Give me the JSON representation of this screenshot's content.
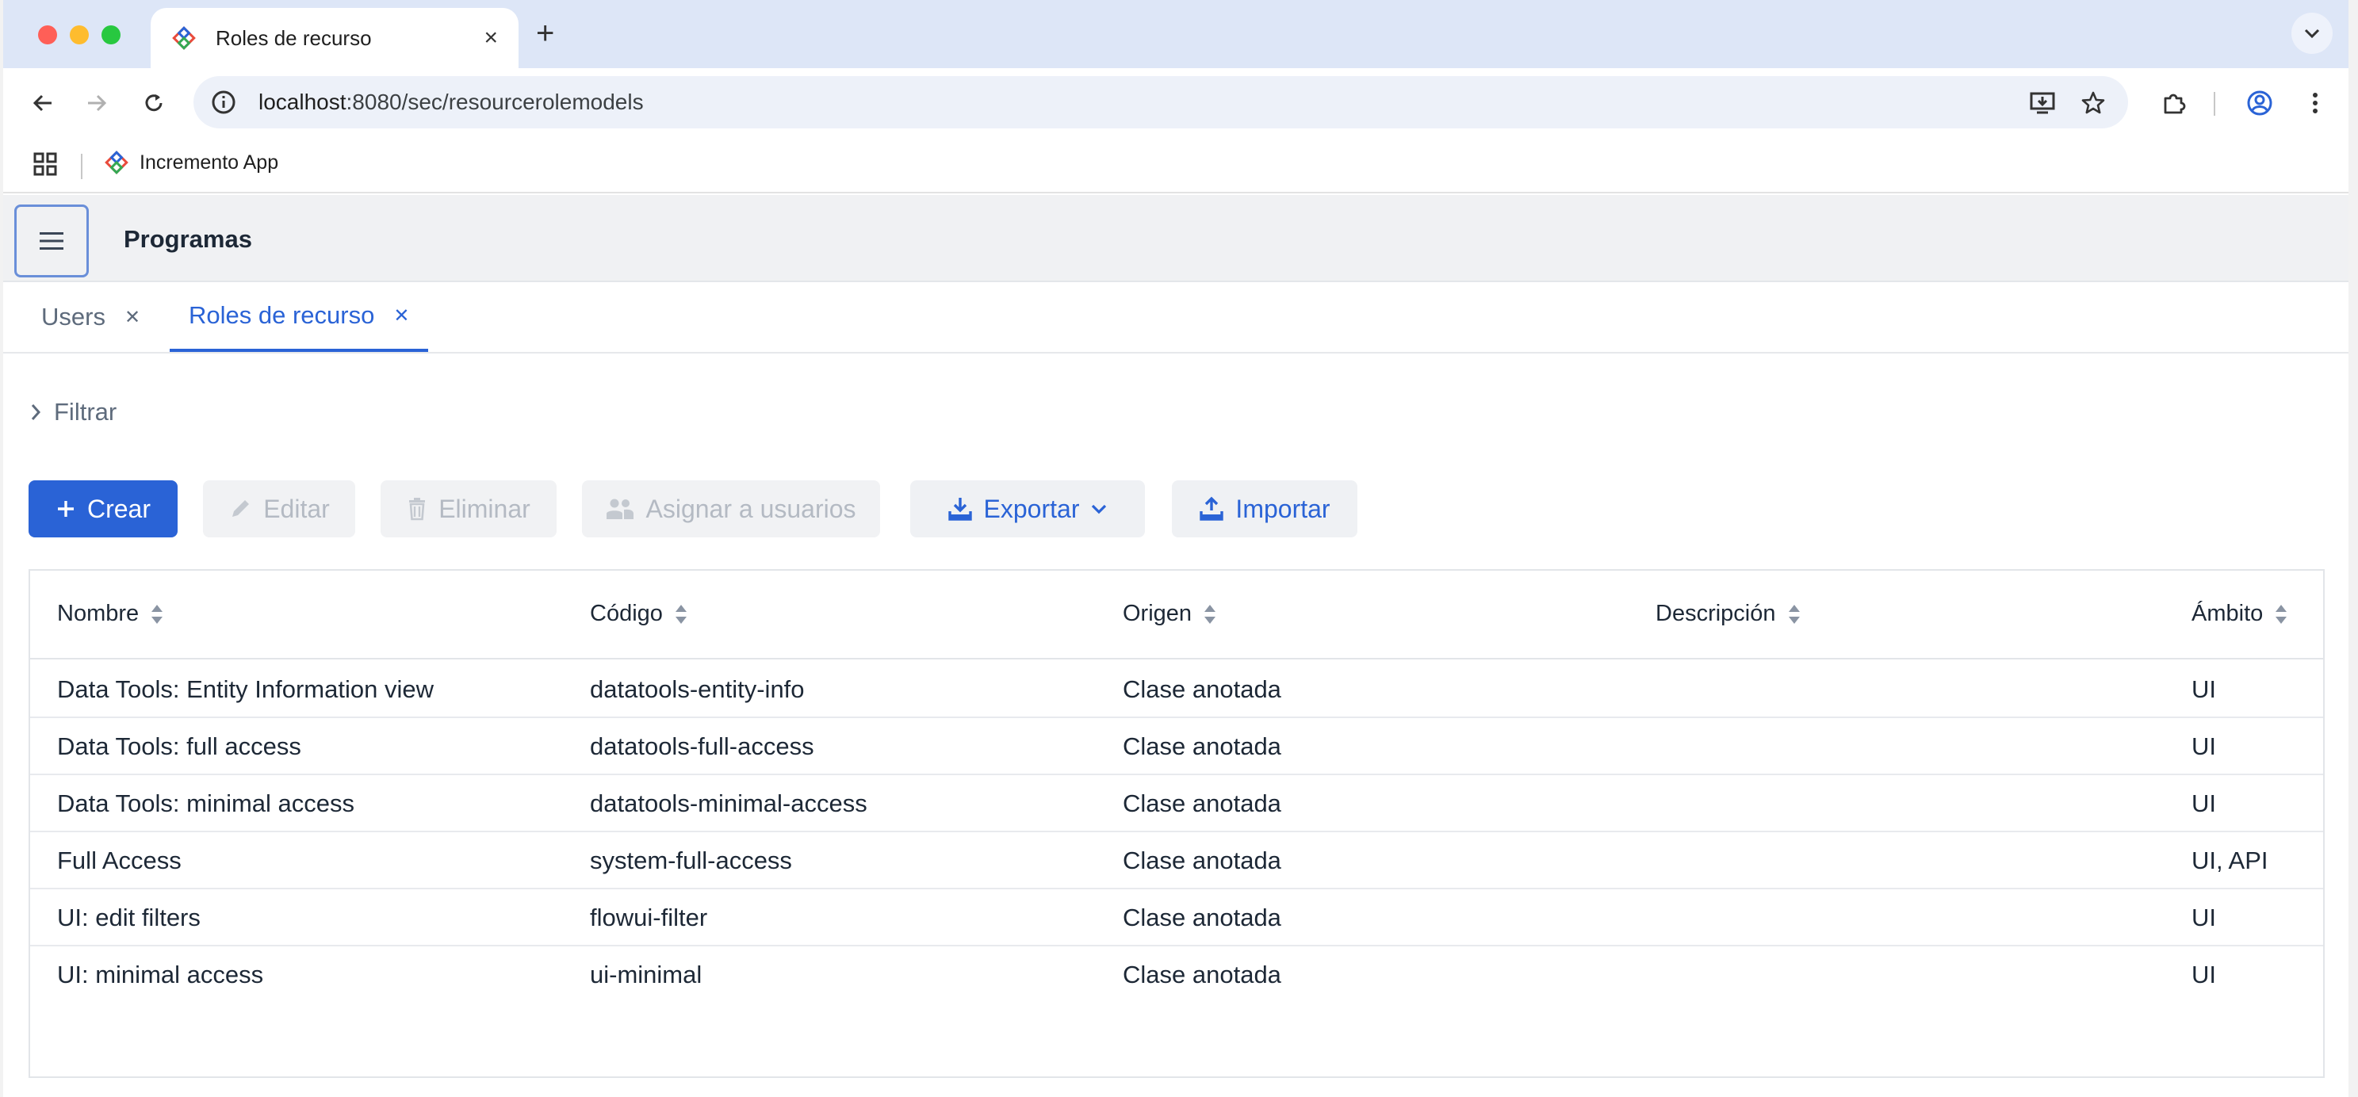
{
  "browser": {
    "tab_title": "Roles de recurso",
    "url_host": "localhost",
    "url_rest": ":8080/sec/resourcerolemodels",
    "bookmark_label": "Incremento App",
    "colors": {
      "close": "#ff5f57",
      "minimize": "#febc2e",
      "zoom": "#28c840"
    }
  },
  "app": {
    "header_title": "Programas",
    "view_tabs": [
      {
        "label": "Users",
        "active": false
      },
      {
        "label": "Roles de recurso",
        "active": true
      }
    ],
    "filter_label": "Filtrar",
    "buttons": {
      "create": "Crear",
      "edit": "Editar",
      "delete": "Eliminar",
      "assign": "Asignar a usuarios",
      "export": "Exportar",
      "import": "Importar"
    },
    "accent_color": "#2a63d6"
  },
  "table": {
    "columns": [
      "Nombre",
      "Código",
      "Origen",
      "Descripción",
      "Ámbito"
    ],
    "rows": [
      {
        "name": "Data Tools: Entity Information view",
        "code": "datatools-entity-info",
        "source": "Clase anotada",
        "description": "",
        "scope": "UI"
      },
      {
        "name": "Data Tools: full access",
        "code": "datatools-full-access",
        "source": "Clase anotada",
        "description": "",
        "scope": "UI"
      },
      {
        "name": "Data Tools: minimal access",
        "code": "datatools-minimal-access",
        "source": "Clase anotada",
        "description": "",
        "scope": "UI"
      },
      {
        "name": "Full Access",
        "code": "system-full-access",
        "source": "Clase anotada",
        "description": "",
        "scope": "UI, API"
      },
      {
        "name": "UI: edit filters",
        "code": "flowui-filter",
        "source": "Clase anotada",
        "description": "",
        "scope": "UI"
      },
      {
        "name": "UI: minimal access",
        "code": "ui-minimal",
        "source": "Clase anotada",
        "description": "",
        "scope": "UI"
      }
    ]
  }
}
